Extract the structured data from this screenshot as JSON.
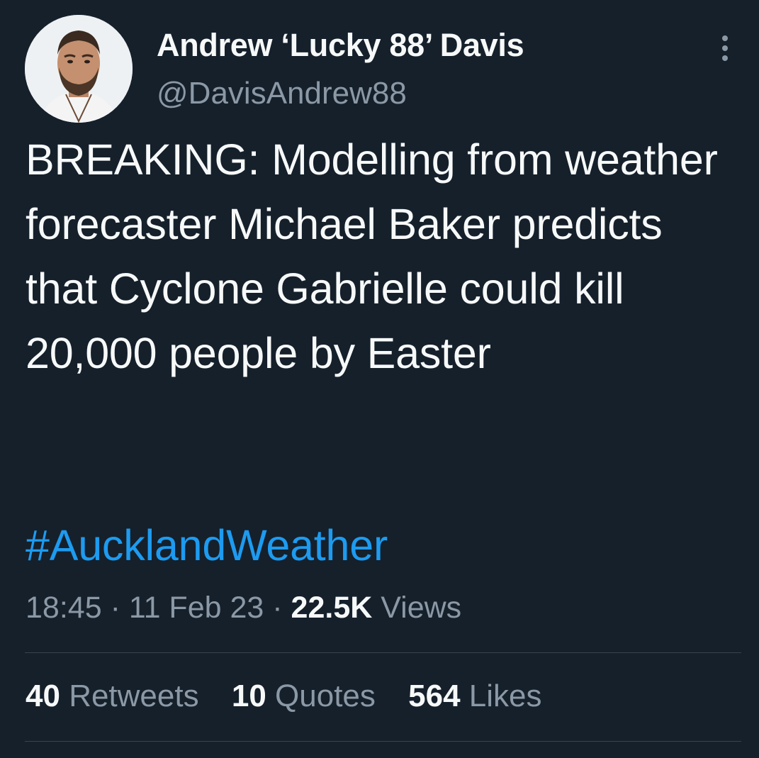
{
  "author": {
    "display_name": "Andrew ‘Lucky 88’ Davis",
    "handle": "@DavisAndrew88",
    "avatar_icon": "profile-photo"
  },
  "tweet": {
    "text": "BREAKING: Modelling from weather forecaster Michael Baker predicts that Cyclone Gabrielle could kill 20,000 people by Easter",
    "hashtag": "#AucklandWeather"
  },
  "meta": {
    "time": "18:45",
    "date": "11 Feb 23",
    "separator": "·",
    "views_count": "22.5K",
    "views_label": "Views"
  },
  "stats": {
    "retweets_count": "40",
    "retweets_label": "Retweets",
    "quotes_count": "10",
    "quotes_label": "Quotes",
    "likes_count": "564",
    "likes_label": "Likes"
  },
  "colors": {
    "background": "#15202b",
    "text_primary": "#f7f9f9",
    "text_secondary": "#8b98a5",
    "link": "#1d9bf0",
    "divider": "#38444d"
  },
  "icons": {
    "more": "more-vertical-icon"
  }
}
